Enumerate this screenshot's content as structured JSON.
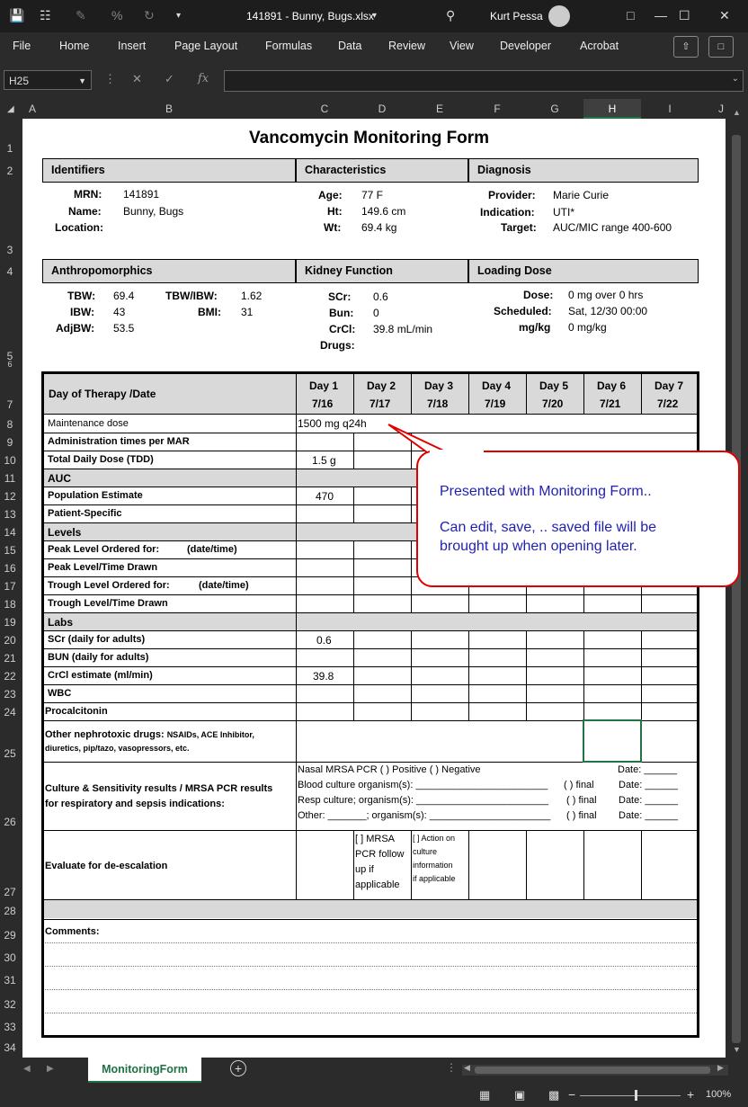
{
  "window": {
    "file_title": "141891 - Bunny, Bugs.xlsx",
    "user_name": "Kurt Pessa"
  },
  "menu": {
    "items": [
      "File",
      "Home",
      "Insert",
      "Page Layout",
      "Formulas",
      "Data",
      "Review",
      "View",
      "Developer",
      "Acrobat"
    ]
  },
  "formula_bar": {
    "name_box": "H25",
    "fx_label": "fx",
    "content": ""
  },
  "columns": [
    "A",
    "B",
    "C",
    "D",
    "E",
    "F",
    "G",
    "H",
    "I",
    "J"
  ],
  "rows": [
    "1",
    "2",
    "3",
    "4",
    "5",
    "6",
    "7",
    "8",
    "9",
    "10",
    "11",
    "12",
    "13",
    "14",
    "15",
    "16",
    "17",
    "18",
    "19",
    "20",
    "21",
    "22",
    "23",
    "24",
    "25",
    "26",
    "27",
    "28",
    "29",
    "30",
    "31",
    "32",
    "33",
    "34"
  ],
  "form": {
    "title": "Vancomycin Monitoring Form",
    "section1": {
      "identifiers": "Identifiers",
      "characteristics": "Characteristics",
      "diagnosis": "Diagnosis",
      "mrn_label": "MRN:",
      "mrn": "141891",
      "name_label": "Name:",
      "name": "Bunny, Bugs",
      "location_label": "Location:",
      "age_label": "Age:",
      "age": "77 F",
      "ht_label": "Ht:",
      "ht": "149.6 cm",
      "wt_label": "Wt:",
      "wt": "69.4 kg",
      "provider_label": "Provider:",
      "provider": "Marie Curie",
      "indication_label": "Indication:",
      "indication": "UTI*",
      "target_label": "Target:",
      "target": "AUC/MIC range 400-600"
    },
    "section2": {
      "anthro": "Anthropomorphics",
      "kidney": "Kidney Function",
      "loading": "Loading Dose",
      "tbw_label": "TBW:",
      "tbw": "69.4",
      "tbwibw_label": "TBW/IBW:",
      "tbwibw": "1.62",
      "ibw_label": "IBW:",
      "ibw": "43",
      "bmi_label": "BMI:",
      "bmi": "31",
      "adjbw_label": "AdjBW:",
      "adjbw": "53.5",
      "scr_label": "SCr:",
      "scr": "0.6",
      "bun_label": "Bun:",
      "bun": "0",
      "crcl_label": "CrCl:",
      "crcl": "39.8 mL/min",
      "drugs_label": "Drugs:",
      "dose_label": "Dose:",
      "dose": "0 mg over 0 hrs",
      "scheduled_label": "Scheduled:",
      "scheduled": "Sat, 12/30 00:00",
      "mgkg_label": "mg/kg",
      "mgkg": "0 mg/kg"
    },
    "grid": {
      "header_label": "Day of Therapy /Date",
      "days": [
        {
          "day": "Day 1",
          "date": "7/16"
        },
        {
          "day": "Day 2",
          "date": "7/17"
        },
        {
          "day": "Day 3",
          "date": "7/18"
        },
        {
          "day": "Day 4",
          "date": "7/19"
        },
        {
          "day": "Day 5",
          "date": "7/20"
        },
        {
          "day": "Day 6",
          "date": "7/21"
        },
        {
          "day": "Day 7",
          "date": "7/22"
        }
      ],
      "maintenance_dose": "Maintenance dose",
      "maintenance_value": "1500 mg q24h",
      "admin_times": "Administration times per MAR",
      "tdd": "Total Daily Dose (TDD)",
      "tdd_value": "1.5 g",
      "auc": "AUC",
      "population_estimate": "Population Estimate",
      "population_value": "470",
      "patient_specific": "Patient-Specific",
      "levels": "Levels",
      "peak_ordered": "Peak Level Ordered for:",
      "peak_ordered_hint": "(date/time)",
      "peak_drawn": "Peak Level/Time Drawn",
      "trough_ordered": "Trough Level Ordered for:",
      "trough_ordered_hint": "(date/time)",
      "trough_drawn": "Trough Level/Time Drawn",
      "labs": "Labs",
      "scr_daily": "SCr (daily for adults)",
      "scr_value": "0.6",
      "bun_daily": "BUN (daily for adults)",
      "crcl_estimate": "CrCl estimate (ml/min)",
      "crcl_value": "39.8",
      "wbc": "WBC",
      "procalcitonin": "Procalcitonin",
      "nephro_main": "Other nephrotoxic drugs:",
      "nephro_rest1": "NSAIDs, ACE Inhibitor,",
      "nephro_rest2": "diuretics, pip/tazo,  vasopressors, etc.",
      "culture_line1": "Culture & Sensitivity results / MRSA PCR results",
      "culture_line2": "for respiratory and sepsis indications:",
      "c_nasal": "Nasal MRSA PCR (  ) Positive (  ) Negative",
      "c_blood": "Blood culture organism(s): ________________________",
      "c_resp": "Resp culture; organism(s): ________________________",
      "c_other": "Other: _______; organism(s): ______________________",
      "final_blood": "( ) final",
      "final_resp": "( ) final",
      "final_other": "( ) final",
      "date_nasal": "Date: ______",
      "date_blood": "Date: ______",
      "date_resp": "Date: ______",
      "date_other": "Date: ______",
      "deescalation": "Evaluate for de-escalation",
      "mrsa_l1": "[  ] MRSA",
      "mrsa_l2": "PCR follow",
      "mrsa_l3": "up if",
      "mrsa_l4": "applicable",
      "action_l1": "[ ] Action on",
      "action_l2": "culture",
      "action_l3": "information",
      "action_l4": "if applicable",
      "comments": "Comments:"
    }
  },
  "callout": {
    "line1": "Presented with Monitoring Form..",
    "line2": "Can edit, save, .. saved file will be",
    "line3": "brought up when opening later."
  },
  "sheet_tab": "MonitoringForm",
  "zoom": "100%"
}
